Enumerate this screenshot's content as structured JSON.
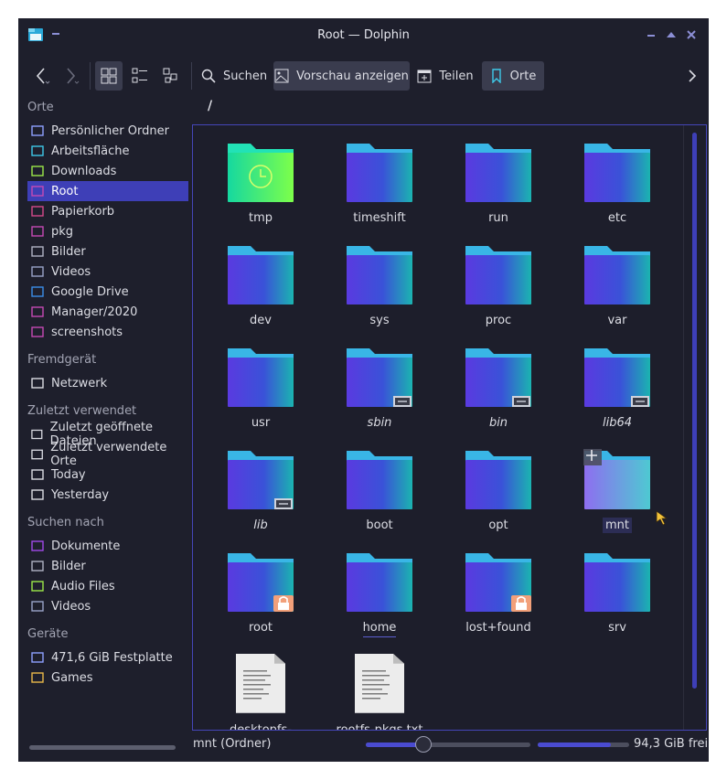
{
  "window": {
    "title": "Root — Dolphin"
  },
  "toolbar": {
    "search_label": "Suchen",
    "preview_label": "Vorschau anzeigen",
    "share_label": "Teilen",
    "places_label": "Orte"
  },
  "sidebar": {
    "sections": [
      {
        "title": "Orte",
        "items": [
          {
            "label": "Persönlicher Ordner",
            "icon": "home-icon"
          },
          {
            "label": "Arbeitsfläche",
            "icon": "desktop-icon"
          },
          {
            "label": "Downloads",
            "icon": "download-icon"
          },
          {
            "label": "Root",
            "icon": "folder-icon",
            "selected": true
          },
          {
            "label": "Papierkorb",
            "icon": "trash-icon"
          },
          {
            "label": "pkg",
            "icon": "folder-icon"
          },
          {
            "label": "Bilder",
            "icon": "image-icon"
          },
          {
            "label": "Videos",
            "icon": "video-icon"
          },
          {
            "label": "Google Drive",
            "icon": "cloud-icon"
          },
          {
            "label": "Manager/2020",
            "icon": "folder-icon"
          },
          {
            "label": "screenshots",
            "icon": "folder-icon"
          }
        ]
      },
      {
        "title": "Fremdgerät",
        "items": [
          {
            "label": "Netzwerk",
            "icon": "network-icon"
          }
        ]
      },
      {
        "title": "Zuletzt verwendet",
        "items": [
          {
            "label": "Zuletzt geöffnete Dateien",
            "icon": "recent-file-icon"
          },
          {
            "label": "Zuletzt verwendete Orte",
            "icon": "recent-folder-icon"
          },
          {
            "label": "Today",
            "icon": "calendar-icon"
          },
          {
            "label": "Yesterday",
            "icon": "calendar-icon"
          }
        ]
      },
      {
        "title": "Suchen nach",
        "items": [
          {
            "label": "Dokumente",
            "icon": "document-icon"
          },
          {
            "label": "Bilder",
            "icon": "image-icon"
          },
          {
            "label": "Audio Files",
            "icon": "music-icon"
          },
          {
            "label": "Videos",
            "icon": "video-icon"
          }
        ]
      },
      {
        "title": "Geräte",
        "items": [
          {
            "label": "471,6 GiB Festplatte",
            "icon": "harddisk-icon"
          },
          {
            "label": "Games",
            "icon": "drive-icon"
          }
        ]
      }
    ]
  },
  "location": {
    "path": "/"
  },
  "files": [
    {
      "name": "tmp",
      "kind": "folder-temp"
    },
    {
      "name": "timeshift",
      "kind": "folder"
    },
    {
      "name": "run",
      "kind": "folder"
    },
    {
      "name": "etc",
      "kind": "folder"
    },
    {
      "name": "dev",
      "kind": "folder"
    },
    {
      "name": "sys",
      "kind": "folder"
    },
    {
      "name": "proc",
      "kind": "folder"
    },
    {
      "name": "var",
      "kind": "folder"
    },
    {
      "name": "usr",
      "kind": "folder"
    },
    {
      "name": "sbin",
      "kind": "folder",
      "symlink": true
    },
    {
      "name": "bin",
      "kind": "folder",
      "symlink": true
    },
    {
      "name": "lib64",
      "kind": "folder",
      "symlink": true
    },
    {
      "name": "lib",
      "kind": "folder",
      "symlink": true
    },
    {
      "name": "boot",
      "kind": "folder"
    },
    {
      "name": "opt",
      "kind": "folder"
    },
    {
      "name": "mnt",
      "kind": "folder",
      "hovered": true
    },
    {
      "name": "root",
      "kind": "folder",
      "locked": true
    },
    {
      "name": "home",
      "kind": "folder",
      "underlined": true
    },
    {
      "name": "lost+found",
      "kind": "folder",
      "locked": true
    },
    {
      "name": "srv",
      "kind": "folder"
    },
    {
      "name": "desktopfs-pkgs.txt",
      "kind": "text-file"
    },
    {
      "name": "rootfs-pkgs.txt",
      "kind": "text-file"
    }
  ],
  "status": {
    "selection_text": "mnt (Ordner)",
    "zoom_level": 0.35,
    "disk_used_fraction": 0.8,
    "free_space": "94,3 GiB frei"
  },
  "colors": {
    "accent": "#3e3fb7",
    "background": "#1e1f2c"
  }
}
